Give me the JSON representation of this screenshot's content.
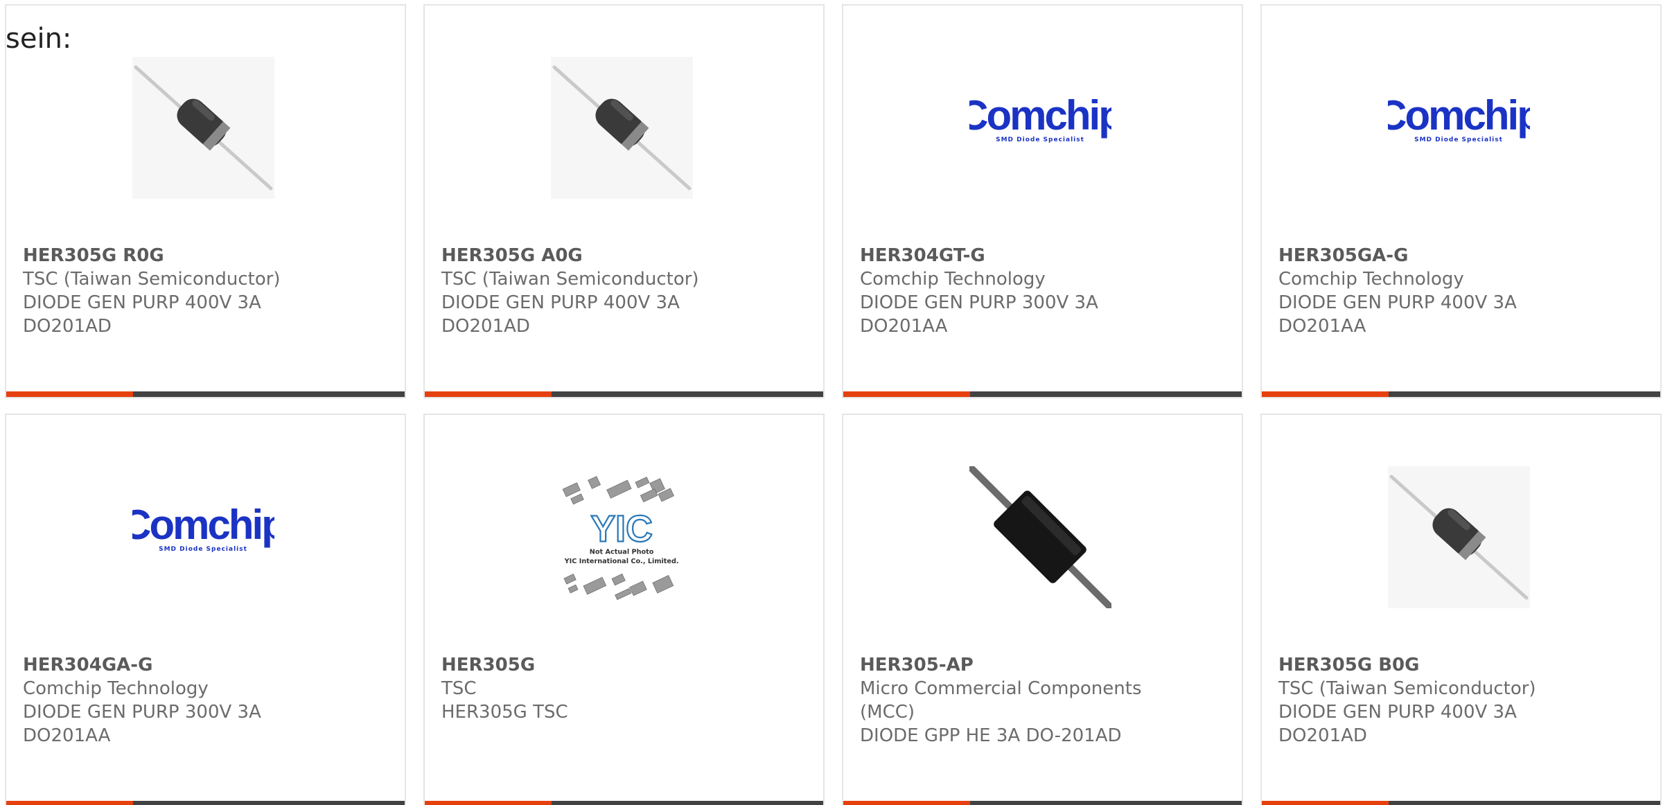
{
  "intro_text": "sein:",
  "colors": {
    "accent": "#e6400f",
    "bar": "#424242",
    "text": "#6b6b6b",
    "comchip_blue": "#1b33c4"
  },
  "products": [
    {
      "part_number": "HER305G R0G",
      "manufacturer": "TSC (Taiwan Semiconductor)",
      "description": "DIODE GEN PURP 400V 3A",
      "package": "DO201AD",
      "image": "axial-diode-photo"
    },
    {
      "part_number": "HER305G A0G",
      "manufacturer": "TSC (Taiwan Semiconductor)",
      "description": "DIODE GEN PURP 400V 3A",
      "package": "DO201AD",
      "image": "axial-diode-photo"
    },
    {
      "part_number": "HER304GT-G",
      "manufacturer": "Comchip Technology",
      "description": "DIODE GEN PURP 300V 3A",
      "package": "DO201AA",
      "image": "comchip-logo"
    },
    {
      "part_number": "HER305GA-G",
      "manufacturer": "Comchip Technology",
      "description": "DIODE GEN PURP 400V 3A",
      "package": "DO201AA",
      "image": "comchip-logo"
    },
    {
      "part_number": "HER304GA-G",
      "manufacturer": "Comchip Technology",
      "description": "DIODE GEN PURP 300V 3A",
      "package": "DO201AA",
      "image": "comchip-logo"
    },
    {
      "part_number": "HER305G",
      "manufacturer": "TSC",
      "description": "HER305G TSC",
      "package": "",
      "image": "yic-placeholder"
    },
    {
      "part_number": "HER305-AP",
      "manufacturer": "Micro Commercial Components\n(MCC)",
      "description": "DIODE GPP HE 3A DO-201AD",
      "package": "",
      "image": "large-diode-photo"
    },
    {
      "part_number": "HER305G B0G",
      "manufacturer": "TSC (Taiwan Semiconductor)",
      "description": "DIODE GEN PURP 400V 3A",
      "package": "DO201AD",
      "image": "axial-diode-photo"
    }
  ],
  "logos": {
    "comchip_word": "Comchip",
    "comchip_tagline": "SMD Diode Specialist",
    "yic_mark": "YIC",
    "yic_line1": "Not Actual Photo",
    "yic_line2": "YIC International Co., Limited."
  }
}
